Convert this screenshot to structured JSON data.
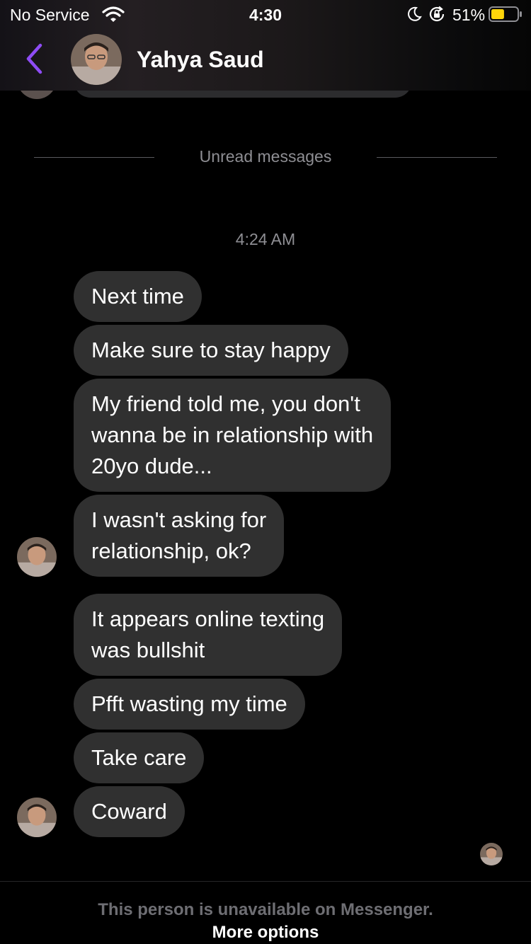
{
  "status_bar": {
    "carrier": "No Service",
    "time": "4:30",
    "battery": "51%",
    "battery_level": 0.51,
    "icons": [
      "wifi-icon",
      "moon-icon",
      "orientation-lock-icon",
      "battery-icon"
    ]
  },
  "header": {
    "contact_name": "Yahya Saud",
    "back_icon": "chevron-left-icon",
    "accent_color": "#8e4cf5"
  },
  "thread": {
    "unread_label": "Unread messages",
    "timestamp": "4:24 AM",
    "messages": [
      "Next time",
      "Make sure to stay happy",
      "My friend told me, you don't\nwanna be in relationship with\n20yo dude...",
      "I wasn't asking for\nrelationship, ok?",
      "It appears online texting\nwas bullshit",
      "Pfft wasting my time",
      "Take care",
      "Coward"
    ]
  },
  "footer": {
    "note": "This person is unavailable on Messenger.",
    "link": "More options"
  }
}
